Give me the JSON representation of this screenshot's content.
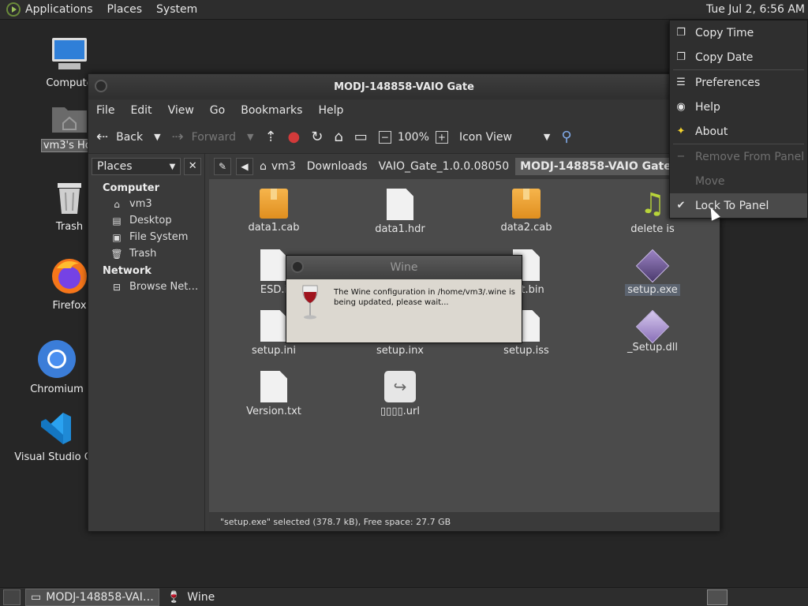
{
  "top_panel": {
    "menus": [
      "Applications",
      "Places",
      "System"
    ],
    "clock": "Tue Jul  2,  6:56 AM"
  },
  "desktop_icons": [
    {
      "label": "Compute"
    },
    {
      "label": "vm3's Hor"
    },
    {
      "label": "Trash"
    },
    {
      "label": "Firefox"
    },
    {
      "label": "Chromium"
    },
    {
      "label": "Visual Studio Co"
    }
  ],
  "file_manager": {
    "title": "MODJ-148858-VAIO Gate",
    "menu": [
      "File",
      "Edit",
      "View",
      "Go",
      "Bookmarks",
      "Help"
    ],
    "toolbar": {
      "back": "Back",
      "forward": "Forward",
      "zoom": "100%",
      "view_mode": "Icon View"
    },
    "sidebar": {
      "selector": "Places",
      "close": "✕",
      "sections": [
        {
          "title": "Computer",
          "items": [
            "vm3",
            "Desktop",
            "File System",
            "Trash"
          ]
        },
        {
          "title": "Network",
          "items": [
            "Browse Net…"
          ]
        }
      ]
    },
    "path": [
      "vm3",
      "Downloads",
      "VAIO_Gate_1.0.0.08050",
      "MODJ-148858-VAIO Gate"
    ],
    "files": [
      {
        "name": "data1.cab"
      },
      {
        "name": "data1.hdr"
      },
      {
        "name": "data2.cab"
      },
      {
        "name": "delete is"
      },
      {
        "name": "ESD.i"
      },
      {
        "name": "out.bin"
      },
      {
        "name": "setup.exe"
      },
      {
        "name": "setup.ini"
      },
      {
        "name": "setup.inx"
      },
      {
        "name": "setup.iss"
      },
      {
        "name": "_Setup.dll"
      },
      {
        "name": "Version.txt"
      },
      {
        "name": "▯▯▯▯.url"
      }
    ],
    "status": "\"setup.exe\" selected (378.7 kB), Free space: 27.7 GB"
  },
  "wine_dialog": {
    "title": "Wine",
    "message": "The Wine configuration in /home/vm3/.wine is being updated, please wait..."
  },
  "context_menu": {
    "items": [
      {
        "label": "Copy Time",
        "icon": "copy-icon",
        "state": "normal"
      },
      {
        "label": "Copy Date",
        "icon": "copy-icon",
        "state": "normal"
      },
      {
        "label": "Preferences",
        "icon": "preferences-icon",
        "state": "normal"
      },
      {
        "label": "Help",
        "icon": "help-icon",
        "state": "normal"
      },
      {
        "label": "About",
        "icon": "star-icon",
        "state": "normal"
      },
      {
        "label": "Remove From Panel",
        "icon": "remove-icon",
        "state": "disabled"
      },
      {
        "label": "Move",
        "icon": "",
        "state": "disabled"
      },
      {
        "label": "Lock To Panel",
        "icon": "check-icon",
        "state": "active"
      }
    ]
  },
  "taskbar": {
    "tasks": [
      {
        "label": "MODJ-148858-VAI…",
        "active": true
      },
      {
        "label": "Wine",
        "active": false
      }
    ]
  }
}
